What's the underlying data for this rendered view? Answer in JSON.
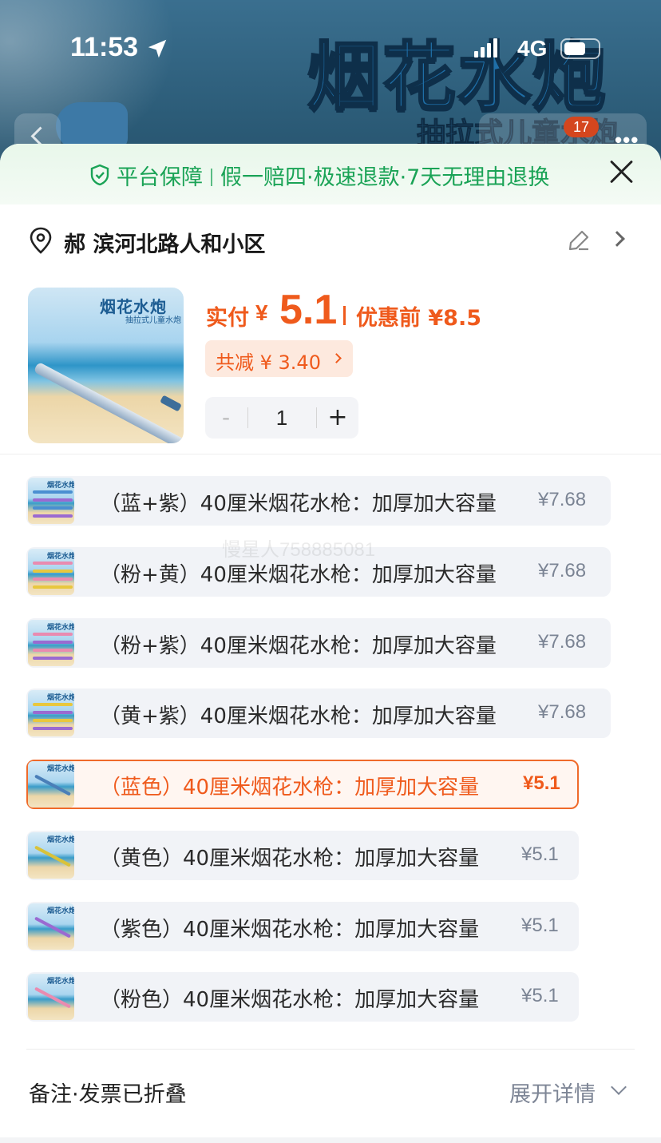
{
  "status_bar": {
    "time": "11:53",
    "network": "4G"
  },
  "banner": {
    "title": "烟花水炮",
    "subtitle": "抽拉式儿童水炮",
    "cart_count": "17"
  },
  "guarantee": {
    "part1": "平台保障",
    "part2": "假一赔四·极速退款·7天无理由退换"
  },
  "address": {
    "text": "郝  滨河北路人和小区"
  },
  "product": {
    "thumb_title": "烟花水炮",
    "thumb_subtitle": "抽拉式儿童水炮",
    "pay_label": "实付",
    "yen": "¥",
    "price": "5.1",
    "before_price": "优惠前 ¥8.5",
    "discount": "共减 ¥ 3.40",
    "quantity": "1",
    "minus": "-",
    "plus": "+"
  },
  "options": [
    {
      "label": "（蓝+紫）40厘米烟花水枪：加厚加大容量",
      "price": "¥7.68",
      "selected": false
    },
    {
      "label": "（粉+黄）40厘米烟花水枪：加厚加大容量",
      "price": "¥7.68",
      "selected": false
    },
    {
      "label": "（粉+紫）40厘米烟花水枪：加厚加大容量",
      "price": "¥7.68",
      "selected": false
    },
    {
      "label": "（黄+紫）40厘米烟花水枪：加厚加大容量",
      "price": "¥7.68",
      "selected": false
    },
    {
      "label": "（蓝色）40厘米烟花水枪：加厚加大容量",
      "price": "¥5.1",
      "selected": true
    },
    {
      "label": "（黄色）40厘米烟花水枪：加厚加大容量",
      "price": "¥5.1",
      "selected": false
    },
    {
      "label": "（紫色）40厘米烟花水枪：加厚加大容量",
      "price": "¥5.1",
      "selected": false
    },
    {
      "label": "（粉色）40厘米烟花水枪：加厚加大容量",
      "price": "¥5.1",
      "selected": false
    }
  ],
  "option_thumb_title": "烟花水炮",
  "watermark": "慢星人758885081",
  "footer": {
    "remark": "备注·发票已折叠",
    "expand": "展开详情"
  },
  "colors": {
    "accent_orange": "#ef5a1c",
    "guarantee_green": "#1aa356"
  }
}
